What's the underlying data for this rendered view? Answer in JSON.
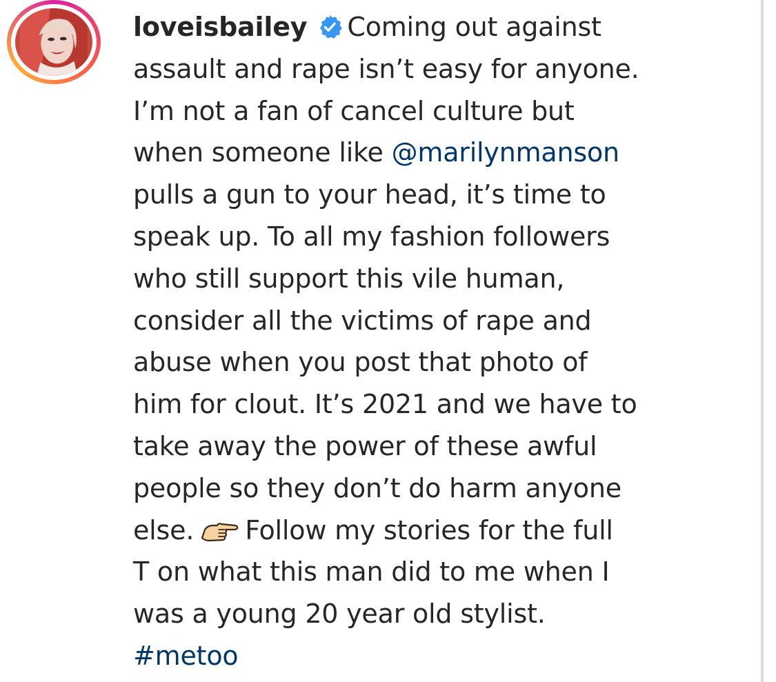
{
  "post": {
    "username": "loveisbailey",
    "verified_icon": "verified-badge-icon",
    "avatar_icon": "profile-avatar",
    "colors": {
      "text": "#262626",
      "link": "#00376b",
      "verified": "#3897f0"
    },
    "caption": {
      "line1": "Coming out against",
      "line2": "assault and rape isn’t easy for anyone.",
      "line3": "I’m not a fan of cancel culture but",
      "line4_pre": "when someone like ",
      "mention": "@marilynmanson",
      "line5": "pulls a gun to your head, it’s time to",
      "line6": "speak up. To all my fashion followers",
      "line7": "who still support this vile human,",
      "line8": "consider all the victims of rape and",
      "line9": "abuse when you post that photo of",
      "line10": "him for clout. It’s 2021 and we have to",
      "line11": "take away the power of these awful",
      "line12": "people so they don’t do harm anyone",
      "line13_pre": "else.",
      "emoji_icon": "pointing-hand-emoji",
      "line13_post": "Follow my stories for the full",
      "line14": "T on what this man did to me when I",
      "line15": "was a young 20 year old stylist.",
      "hashtag": "#metoo"
    }
  }
}
